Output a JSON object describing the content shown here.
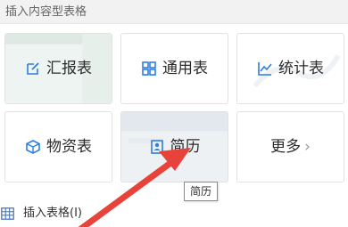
{
  "header": {
    "title": "插入内容型表格"
  },
  "tiles": [
    {
      "label": "汇报表",
      "icon": "edit-square-icon"
    },
    {
      "label": "通用表",
      "icon": "grid-icon"
    },
    {
      "label": "统计表",
      "icon": "line-chart-icon"
    },
    {
      "label": "物资表",
      "icon": "cube-icon"
    },
    {
      "label": "简历",
      "icon": "id-card-icon"
    },
    {
      "label": "更多",
      "icon": "chevron-right-icon"
    }
  ],
  "tooltip": {
    "text": "简历"
  },
  "footer": {
    "insert_table_label": "插入表格(I)",
    "icon": "table-icon"
  },
  "colors": {
    "accent": "#2f7de1",
    "arrow": "#e8433b"
  }
}
